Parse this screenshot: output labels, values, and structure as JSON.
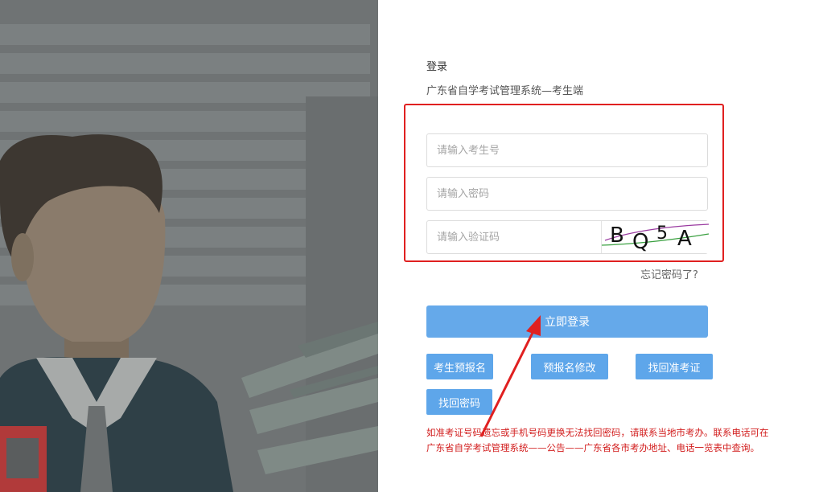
{
  "login": {
    "title": "登录",
    "subtitle": "广东省自学考试管理系统—考生端",
    "username_placeholder": "请输入考生号",
    "password_placeholder": "请输入密码",
    "captcha_placeholder": "请输入验证码",
    "captcha_text": [
      "B",
      "Q",
      "5",
      "A"
    ],
    "forgot_link": "忘记密码了?",
    "login_button": "立即登录"
  },
  "actions": {
    "preregister": "考生预报名",
    "modify_prereg": "预报名修改",
    "retrieve_admission": "找回准考证",
    "retrieve_password": "找回密码"
  },
  "notice": {
    "line1": "如准考证号码遗忘或手机号码更换无法找回密码，请联系当地市考办。联系电话可在",
    "line2": "广东省自学考试管理系统——公告——广东省各市考办地址、电话一览表中查询。"
  },
  "colors": {
    "primary_button": "#65a9ea",
    "secondary_button": "#5ea6ea",
    "highlight_border": "#e02020",
    "notice_text": "#d21e1e"
  }
}
